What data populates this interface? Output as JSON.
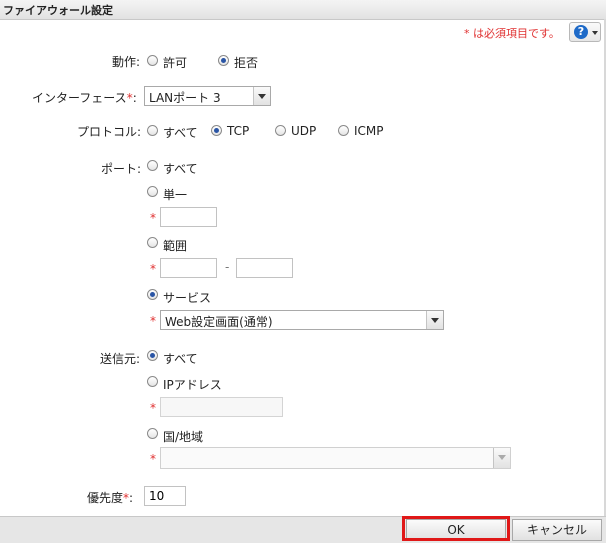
{
  "dialog": {
    "title": "ファイアウォール設定"
  },
  "required_note": "* は必須項目です。",
  "help": {
    "glyph": "?"
  },
  "action": {
    "label": "動作:",
    "options": [
      "許可",
      "拒否"
    ],
    "selected": "拒否"
  },
  "interface": {
    "label": "インターフェース",
    "star": "*",
    "colon": ":",
    "value": "LANポート 3"
  },
  "protocol": {
    "label": "プロトコル:",
    "options": [
      "すべて",
      "TCP",
      "UDP",
      "ICMP"
    ],
    "selected": "TCP"
  },
  "port": {
    "label": "ポート:",
    "options": {
      "all": "すべて",
      "single": "単一",
      "range": "範囲",
      "service": "サービス"
    },
    "selected": "サービス",
    "single_value": "",
    "range_from": "",
    "range_to": "",
    "range_separator": "-",
    "service_value": "Web設定画面(通常)",
    "star": "*"
  },
  "source": {
    "label": "送信元:",
    "options": {
      "all": "すべて",
      "ip": "IPアドレス",
      "country": "国/地域"
    },
    "selected": "すべて",
    "ip_value": "",
    "country_value": "",
    "star": "*"
  },
  "priority": {
    "label": "優先度",
    "star": "*",
    "colon": ":",
    "value": "10"
  },
  "footer": {
    "ok_label": "OK",
    "cancel_label": "キャンセル"
  },
  "colors": {
    "required": "#e03030",
    "highlight": "#e01818",
    "help_blue": "#1e6ac8"
  }
}
